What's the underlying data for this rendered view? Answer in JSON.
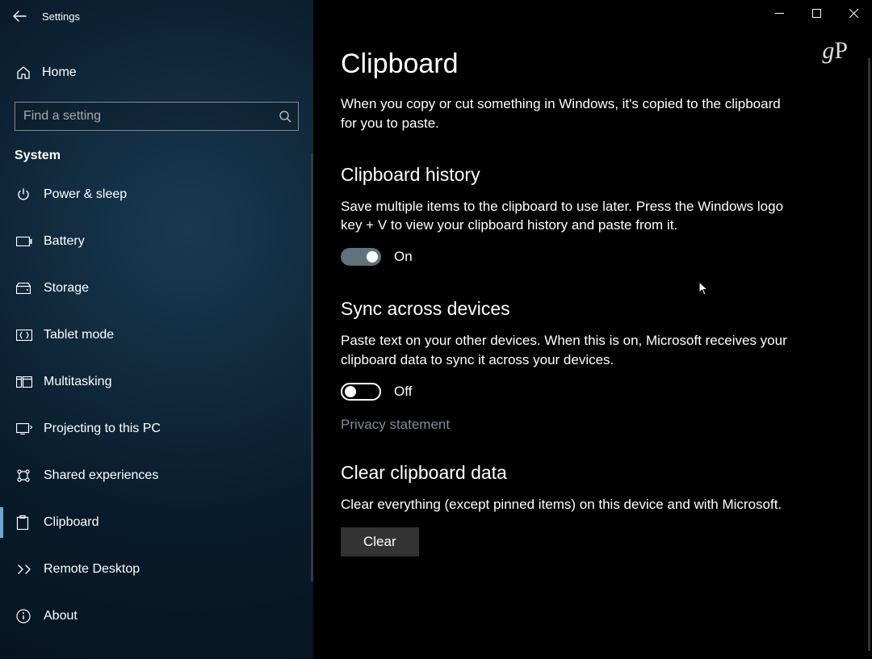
{
  "titlebar": {
    "app_name": "Settings"
  },
  "sidebar": {
    "home_label": "Home",
    "search_placeholder": "Find a setting",
    "section_label": "System",
    "items": [
      {
        "id": "power-sleep",
        "label": "Power & sleep",
        "active": false
      },
      {
        "id": "battery",
        "label": "Battery",
        "active": false
      },
      {
        "id": "storage",
        "label": "Storage",
        "active": false
      },
      {
        "id": "tablet-mode",
        "label": "Tablet mode",
        "active": false
      },
      {
        "id": "multitasking",
        "label": "Multitasking",
        "active": false
      },
      {
        "id": "projecting",
        "label": "Projecting to this PC",
        "active": false
      },
      {
        "id": "shared-exp",
        "label": "Shared experiences",
        "active": false
      },
      {
        "id": "clipboard",
        "label": "Clipboard",
        "active": true
      },
      {
        "id": "remote-desktop",
        "label": "Remote Desktop",
        "active": false
      },
      {
        "id": "about",
        "label": "About",
        "active": false
      }
    ]
  },
  "watermark": "gP",
  "page": {
    "title": "Clipboard",
    "intro": "When you copy or cut something in Windows, it's copied to the clipboard for you to paste.",
    "history": {
      "heading": "Clipboard history",
      "desc": "Save multiple items to the clipboard to use later. Press the Windows logo key + V to view your clipboard history and paste from it.",
      "toggle_state": "On",
      "toggle_on": true
    },
    "sync": {
      "heading": "Sync across devices",
      "desc": "Paste text on your other devices. When this is on, Microsoft receives your clipboard data to sync it across your devices.",
      "toggle_state": "Off",
      "toggle_on": false,
      "privacy_link": "Privacy statement"
    },
    "clear": {
      "heading": "Clear clipboard data",
      "desc": "Clear everything (except pinned items) on this device and with Microsoft.",
      "button_label": "Clear"
    }
  }
}
